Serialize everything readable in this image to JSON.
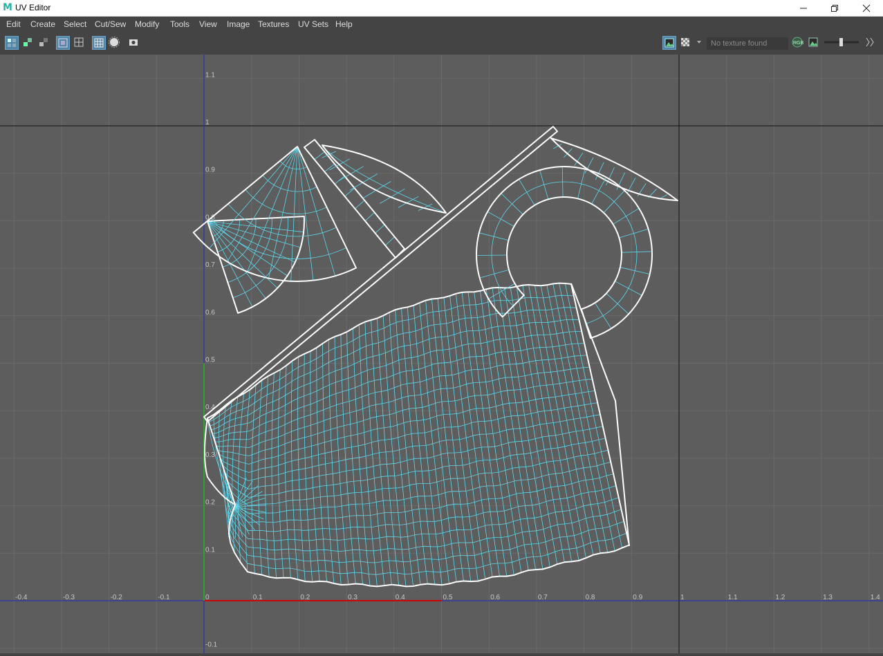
{
  "window": {
    "title": "UV Editor",
    "app_icon": "maya-m-icon",
    "app_letter": "M"
  },
  "menu": [
    "Edit",
    "Create",
    "Select",
    "Cut/Sew",
    "Modify",
    "Tools",
    "View",
    "Image",
    "Textures",
    "UV Sets",
    "Help"
  ],
  "toolbar": {
    "texture_field": "No texture found"
  },
  "grid": {
    "u_labels": [
      "-0.4",
      "-0.3",
      "-0.2",
      "-0.1",
      "0",
      "0.1",
      "0.2",
      "0.3",
      "0.4",
      "0.5",
      "0.6",
      "0.7",
      "0.8",
      "0.9",
      "1",
      "1.1",
      "1.2",
      "1.3",
      "1.4"
    ],
    "v_labels": [
      "1.1",
      "1",
      "0.9",
      "0.8",
      "0.7",
      "0.6",
      "0.5",
      "0.4",
      "0.3",
      "0.2",
      "0.1",
      "-0.1"
    ]
  },
  "colors": {
    "viewport_bg": "#5d5d5d",
    "grid_line": "#6a6a6a",
    "uv_wire": "#5fd8ec",
    "uv_border": "#ffffff",
    "u_axis": "#2222cc",
    "v_axis": "#2222cc",
    "u_axis_highlight": "#d00000",
    "v_axis_highlight": "#22aa22",
    "unit_boundary": "#111111"
  }
}
